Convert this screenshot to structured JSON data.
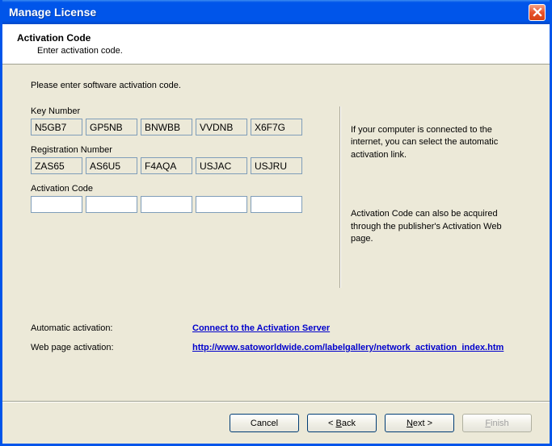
{
  "window": {
    "title": "Manage License"
  },
  "header": {
    "title": "Activation Code",
    "description": "Enter activation code."
  },
  "instruction": "Please enter software activation code.",
  "fields": {
    "key_number": {
      "label": "Key Number",
      "values": [
        "N5GB7",
        "GP5NB",
        "BNWBB",
        "VVDNB",
        "X6F7G"
      ]
    },
    "registration_number": {
      "label": "Registration Number",
      "values": [
        "ZAS65",
        "AS6U5",
        "F4AQA",
        "USJAC",
        "USJRU"
      ]
    },
    "activation_code": {
      "label": "Activation Code",
      "values": [
        "",
        "",
        "",
        "",
        ""
      ]
    }
  },
  "side_info": {
    "para1": "If your computer is connected to the internet, you can select the automatic activation link.",
    "para2": "Activation Code can also be acquired through the publisher's Activation Web page."
  },
  "links": {
    "automatic": {
      "label": "Automatic activation:",
      "text": "Connect to the Activation Server"
    },
    "webpage": {
      "label": "Web page activation:",
      "text": "http://www.satoworldwide.com/labelgallery/network_activation_index.htm"
    }
  },
  "buttons": {
    "cancel": "Cancel",
    "back_prefix": "< ",
    "back_u": "B",
    "back_suffix": "ack",
    "next_u": "N",
    "next_suffix": "ext >",
    "finish_u": "F",
    "finish_suffix": "inish"
  }
}
